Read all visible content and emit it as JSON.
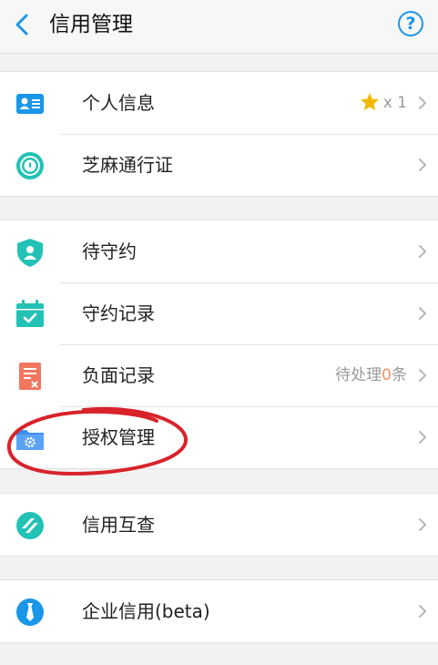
{
  "header": {
    "title": "信用管理",
    "help_label": "?"
  },
  "groups": [
    {
      "items": [
        {
          "label": "个人信息",
          "icon": "id-card-icon",
          "badge_count": "x 1"
        },
        {
          "label": "芝麻通行证",
          "icon": "sesame-pass-icon"
        }
      ]
    },
    {
      "items": [
        {
          "label": "待守约",
          "icon": "shield-user-icon"
        },
        {
          "label": "守约记录",
          "icon": "calendar-check-icon"
        },
        {
          "label": "负面记录",
          "icon": "negative-record-icon",
          "pending_prefix": "待处理",
          "pending_count": "0",
          "pending_suffix": "条"
        },
        {
          "label": "授权管理",
          "icon": "folder-gear-icon"
        }
      ]
    },
    {
      "items": [
        {
          "label": "信用互查",
          "icon": "credit-check-icon"
        }
      ]
    },
    {
      "items": [
        {
          "label": "企业信用(beta)",
          "icon": "enterprise-tie-icon"
        }
      ]
    }
  ],
  "colors": {
    "accent": "#1a96e8",
    "teal": "#23c2b6",
    "negative": "#f2775e",
    "star": "#f5b800",
    "annotation": "#d8232a"
  }
}
